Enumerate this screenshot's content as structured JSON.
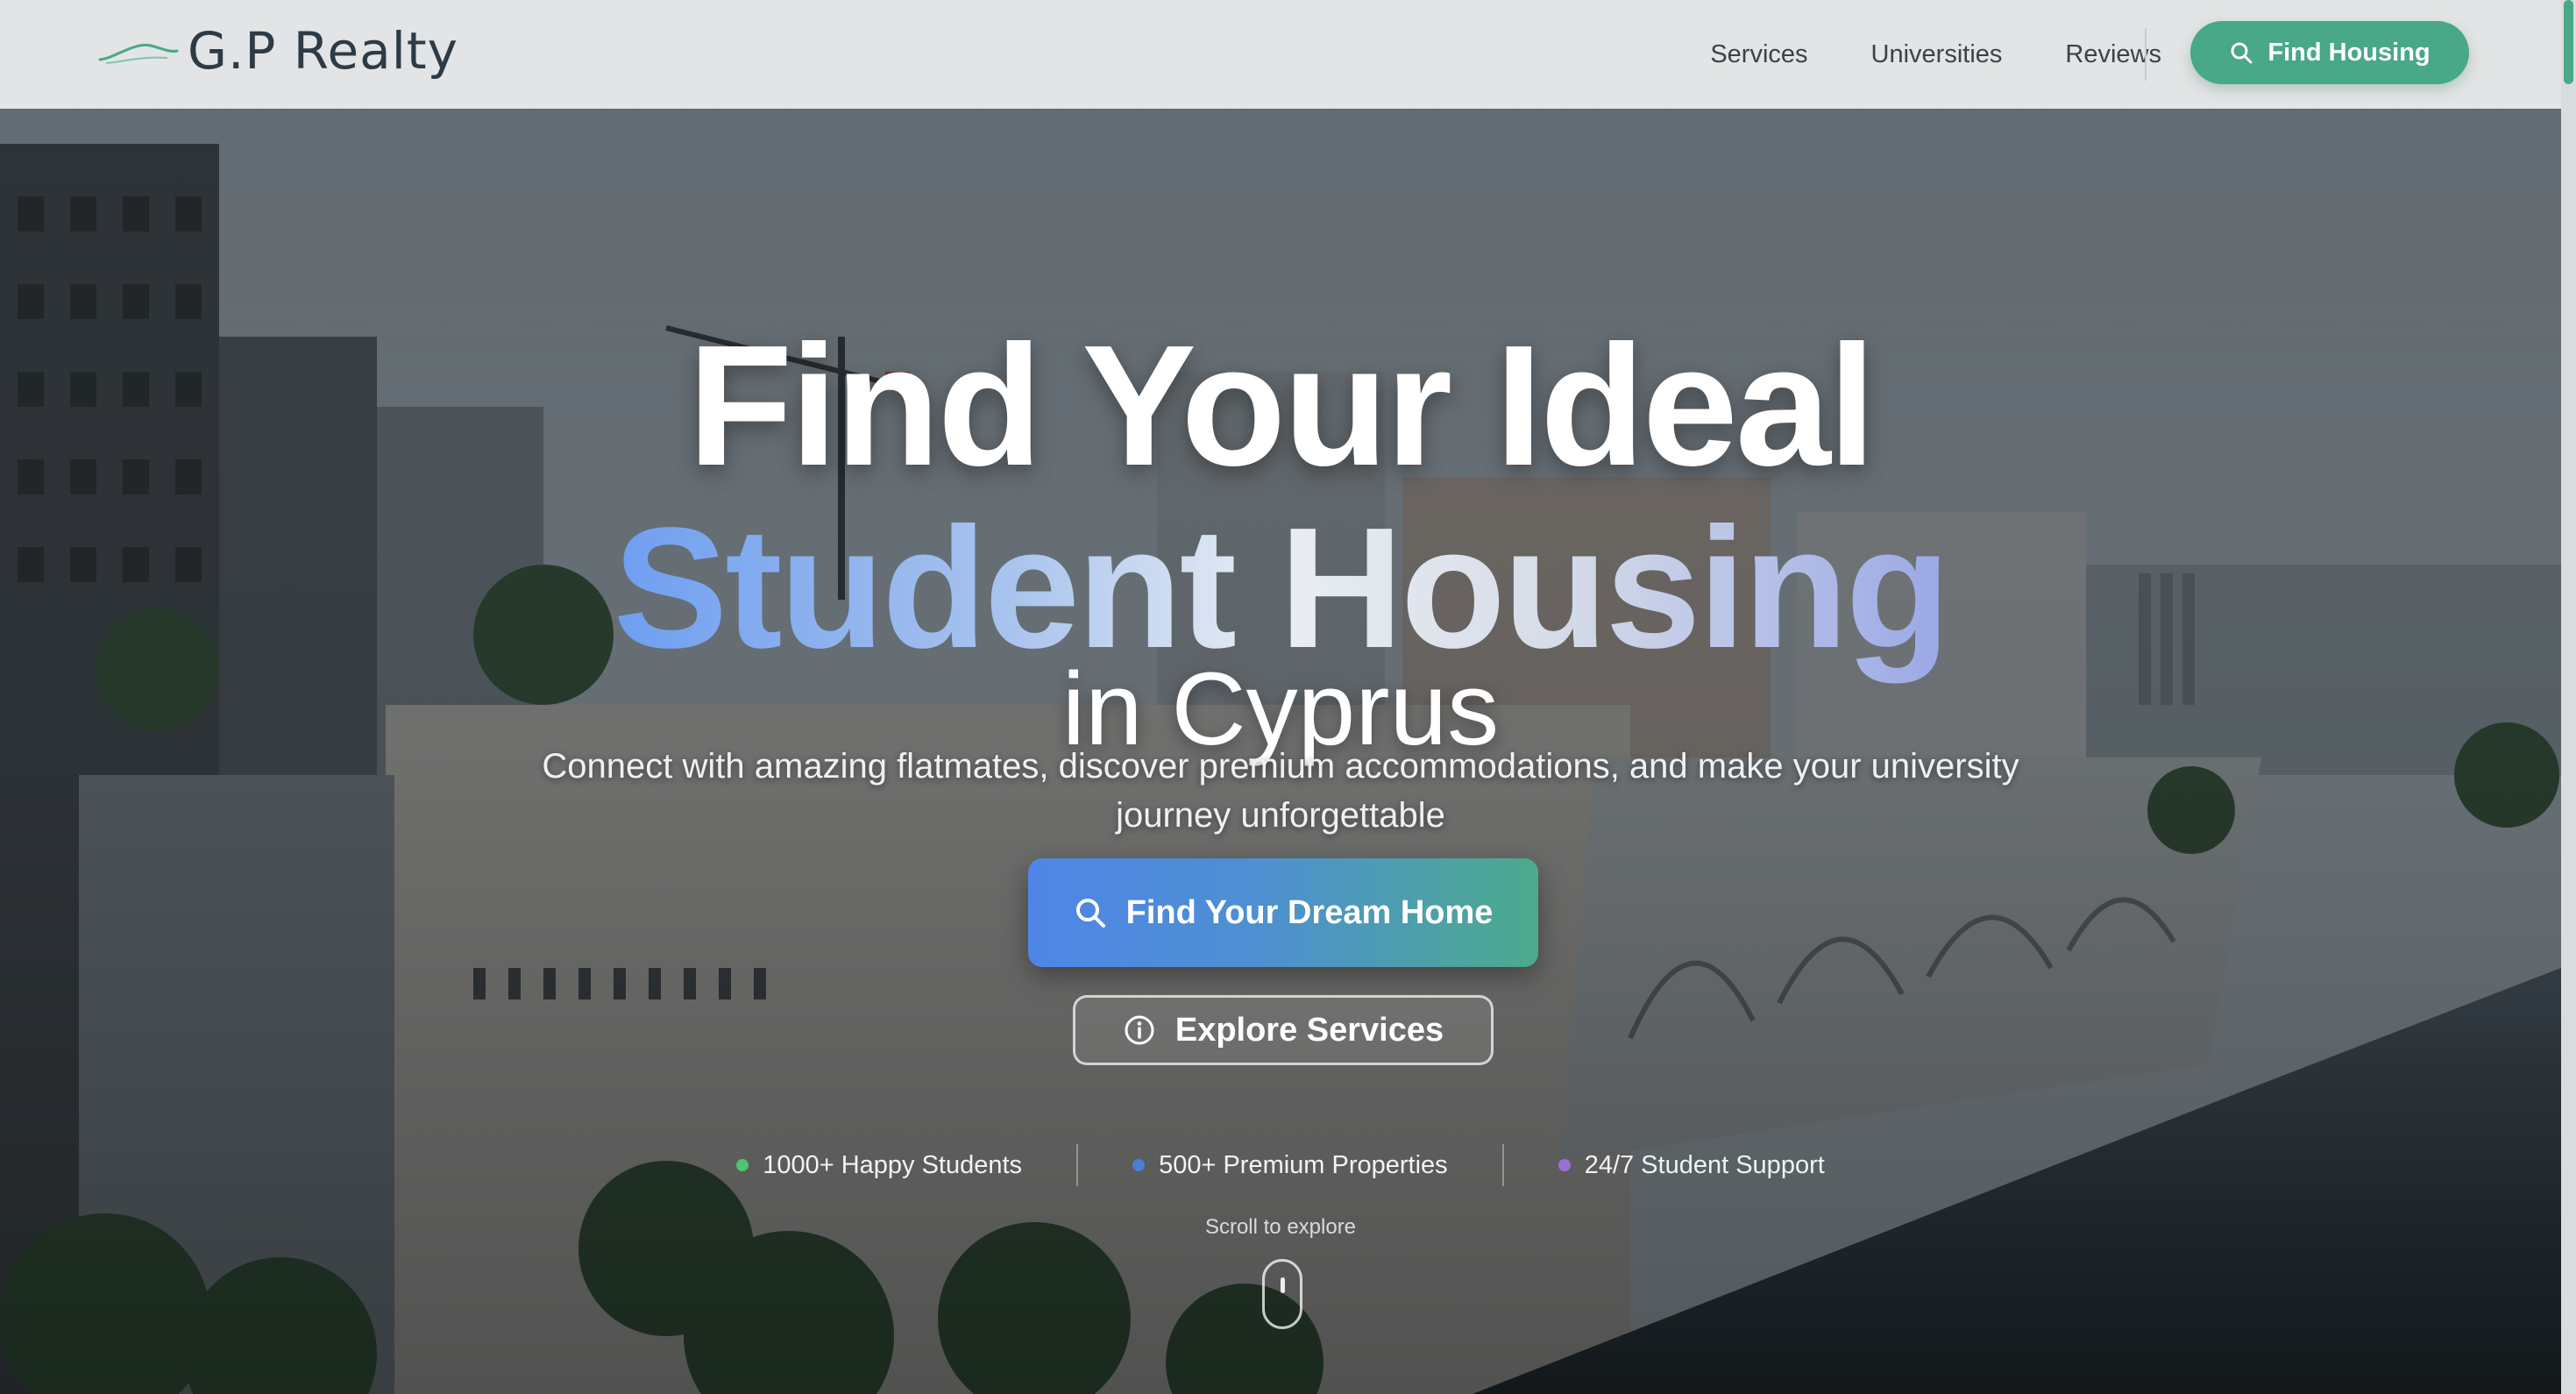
{
  "brand": {
    "name": "G.P Realty"
  },
  "nav": {
    "links": [
      "Services",
      "Universities",
      "Reviews"
    ],
    "cta_label": "Find Housing"
  },
  "hero": {
    "line1": "Find Your Ideal",
    "line2": "Student Housing",
    "line3": "in Cyprus",
    "subtitle": "Connect with amazing flatmates, discover premium accommodations, and make your university journey unforgettable",
    "primary_button": "Find Your Dream Home",
    "secondary_button": "Explore Services",
    "stats": [
      {
        "label": "1000+ Happy Students",
        "dot_color": "#4cc670"
      },
      {
        "label": "500+ Premium Properties",
        "dot_color": "#4a7fd6"
      },
      {
        "label": "24/7 Student Support",
        "dot_color": "#9b6fd8"
      }
    ],
    "scroll_label": "Scroll to explore"
  },
  "colors": {
    "accent_green": "#48a888",
    "accent_blue": "#4f86e6",
    "nav_bg": "#e2e4e5"
  },
  "icons": {
    "nav_cta": "search-icon",
    "primary_button": "search-icon",
    "secondary_button": "info-icon",
    "scroll": "mouse-icon"
  }
}
